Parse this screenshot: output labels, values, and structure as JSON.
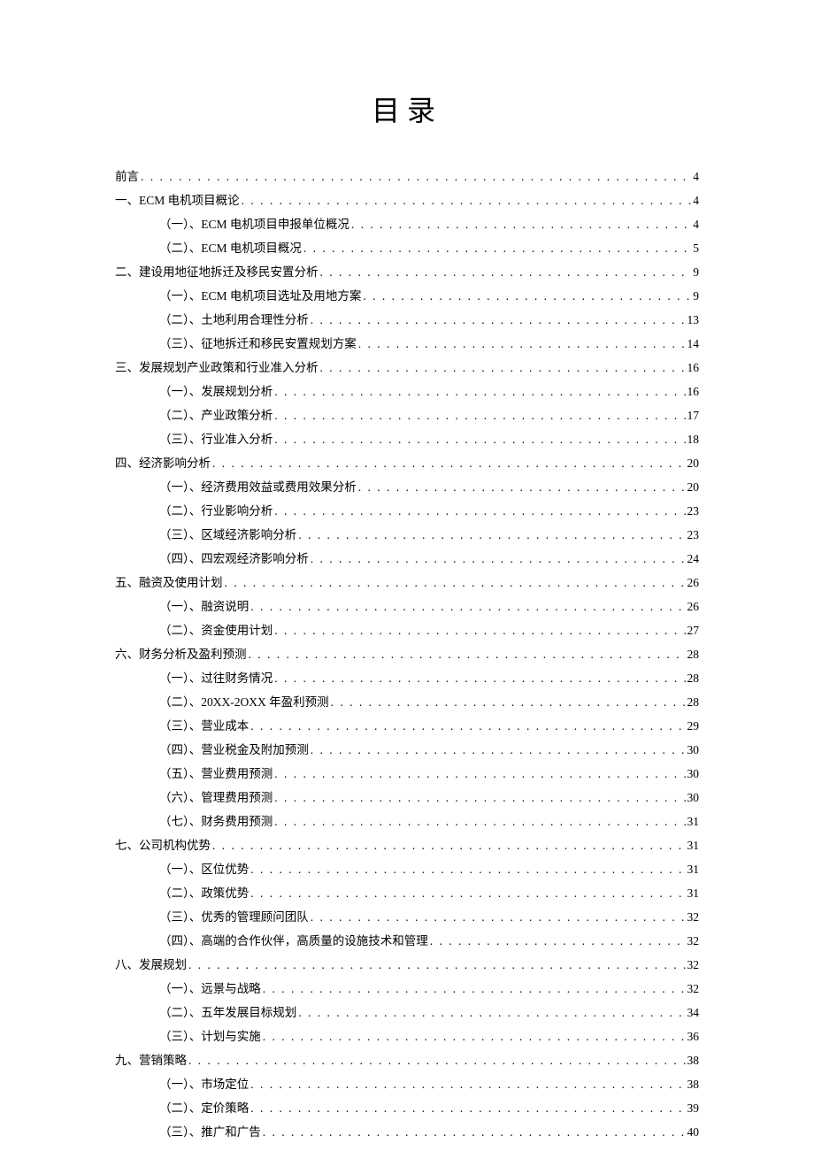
{
  "title": "目录",
  "entries": [
    {
      "level": 1,
      "label": "前言",
      "page": "4"
    },
    {
      "level": 1,
      "label": "一、ECM 电机项目概论",
      "page": "4"
    },
    {
      "level": 2,
      "label": "（一）、ECM 电机项目申报单位概况",
      "page": "4"
    },
    {
      "level": 2,
      "label": "（二）、ECM 电机项目概况",
      "page": "5"
    },
    {
      "level": 1,
      "label": "二、建设用地征地拆迁及移民安置分析",
      "page": "9"
    },
    {
      "level": 2,
      "label": "（一）、ECM 电机项目选址及用地方案",
      "page": "9"
    },
    {
      "level": 2,
      "label": "（二）、土地利用合理性分析",
      "page": "13"
    },
    {
      "level": 2,
      "label": "（三）、征地拆迁和移民安置规划方案",
      "page": "14"
    },
    {
      "level": 1,
      "label": "三、发展规划产业政策和行业准入分析",
      "page": "16"
    },
    {
      "level": 2,
      "label": "（一）、发展规划分析",
      "page": "16"
    },
    {
      "level": 2,
      "label": "（二）、产业政策分析",
      "page": "17"
    },
    {
      "level": 2,
      "label": "（三）、行业准入分析",
      "page": "18"
    },
    {
      "level": 1,
      "label": "四、经济影响分析",
      "page": "20"
    },
    {
      "level": 2,
      "label": "（一）、经济费用效益或费用效果分析",
      "page": "20"
    },
    {
      "level": 2,
      "label": "（二）、行业影响分析",
      "page": "23"
    },
    {
      "level": 2,
      "label": "（三）、区域经济影响分析",
      "page": "23"
    },
    {
      "level": 2,
      "label": "（四）、四宏观经济影响分析",
      "page": "24"
    },
    {
      "level": 1,
      "label": "五、融资及使用计划",
      "page": "26"
    },
    {
      "level": 2,
      "label": "（一）、融资说明",
      "page": "26"
    },
    {
      "level": 2,
      "label": "（二）、资金使用计划",
      "page": "27"
    },
    {
      "level": 1,
      "label": "六、财务分析及盈利预测",
      "page": "28"
    },
    {
      "level": 2,
      "label": "（一）、过往财务情况",
      "page": "28"
    },
    {
      "level": 2,
      "label": "（二）、20XX-2OXX 年盈利预测",
      "page": "28"
    },
    {
      "level": 2,
      "label": "（三）、营业成本",
      "page": "29"
    },
    {
      "level": 2,
      "label": "（四）、营业税金及附加预测",
      "page": "30"
    },
    {
      "level": 2,
      "label": "（五）、营业费用预测",
      "page": "30"
    },
    {
      "level": 2,
      "label": "（六）、管理费用预测",
      "page": "30"
    },
    {
      "level": 2,
      "label": "（七）、财务费用预测",
      "page": "31"
    },
    {
      "level": 1,
      "label": "七、公司机构优势",
      "page": "31"
    },
    {
      "level": 2,
      "label": "（一）、区位优势",
      "page": "31"
    },
    {
      "level": 2,
      "label": "（二）、政策优势",
      "page": "31"
    },
    {
      "level": 2,
      "label": "（三）、优秀的管理顾问团队",
      "page": "32"
    },
    {
      "level": 2,
      "label": "（四）、高端的合作伙伴，高质量的设施技术和管理",
      "page": "32"
    },
    {
      "level": 1,
      "label": "八、发展规划",
      "page": "32"
    },
    {
      "level": 2,
      "label": "（一）、远景与战略",
      "page": "32"
    },
    {
      "level": 2,
      "label": "（二）、五年发展目标规划",
      "page": "34"
    },
    {
      "level": 2,
      "label": "（三）、计划与实施",
      "page": "36"
    },
    {
      "level": 1,
      "label": "九、营销策略",
      "page": "38"
    },
    {
      "level": 2,
      "label": "（一）、市场定位",
      "page": "38"
    },
    {
      "level": 2,
      "label": "（二）、定价策略",
      "page": "39"
    },
    {
      "level": 2,
      "label": "（三）、推广和广告",
      "page": "40"
    }
  ]
}
